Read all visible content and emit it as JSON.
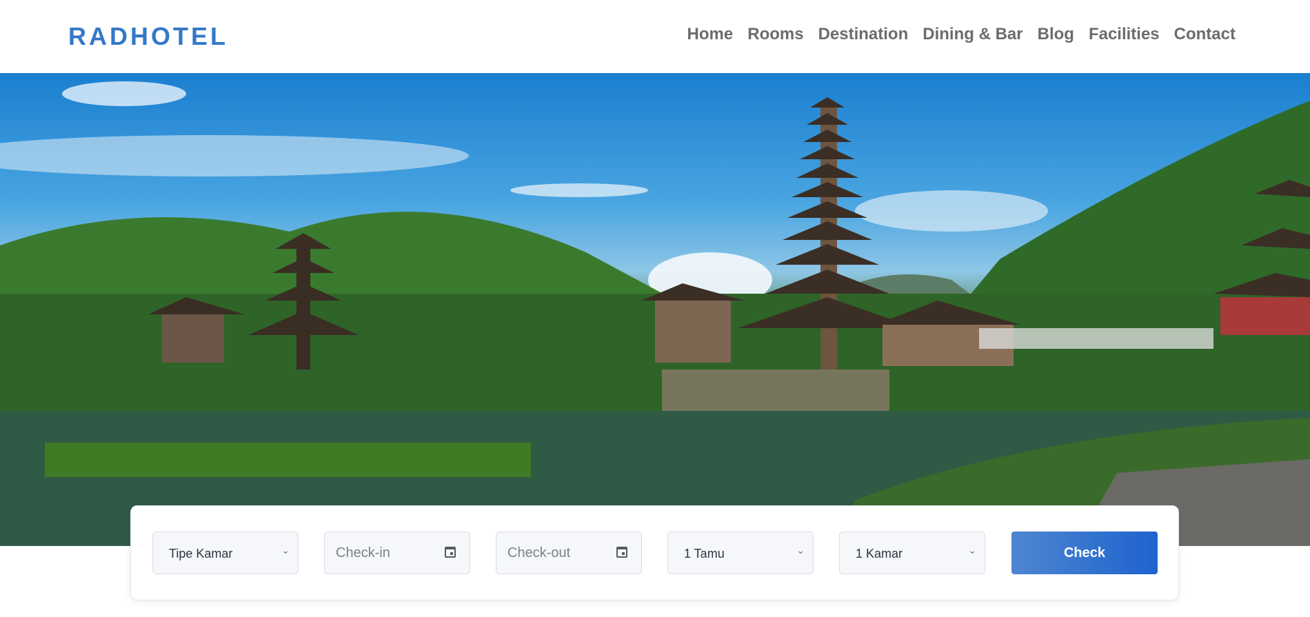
{
  "brand": {
    "logo": "RADHOTEL",
    "accent_color": "#3579c7"
  },
  "nav": {
    "items": [
      "Home",
      "Rooms",
      "Destination",
      "Dining & Bar",
      "Blog",
      "Facilities",
      "Contact"
    ]
  },
  "hero": {
    "image": "lakeside-temple-pagoda-photo"
  },
  "booking": {
    "room_type": "Tipe Kamar",
    "checkin_placeholder": "Check-in",
    "checkout_placeholder": "Check-out",
    "guests": "1 Tamu",
    "rooms": "1 Kamar",
    "check_label": "Check",
    "button_color": "#1e63cf"
  }
}
